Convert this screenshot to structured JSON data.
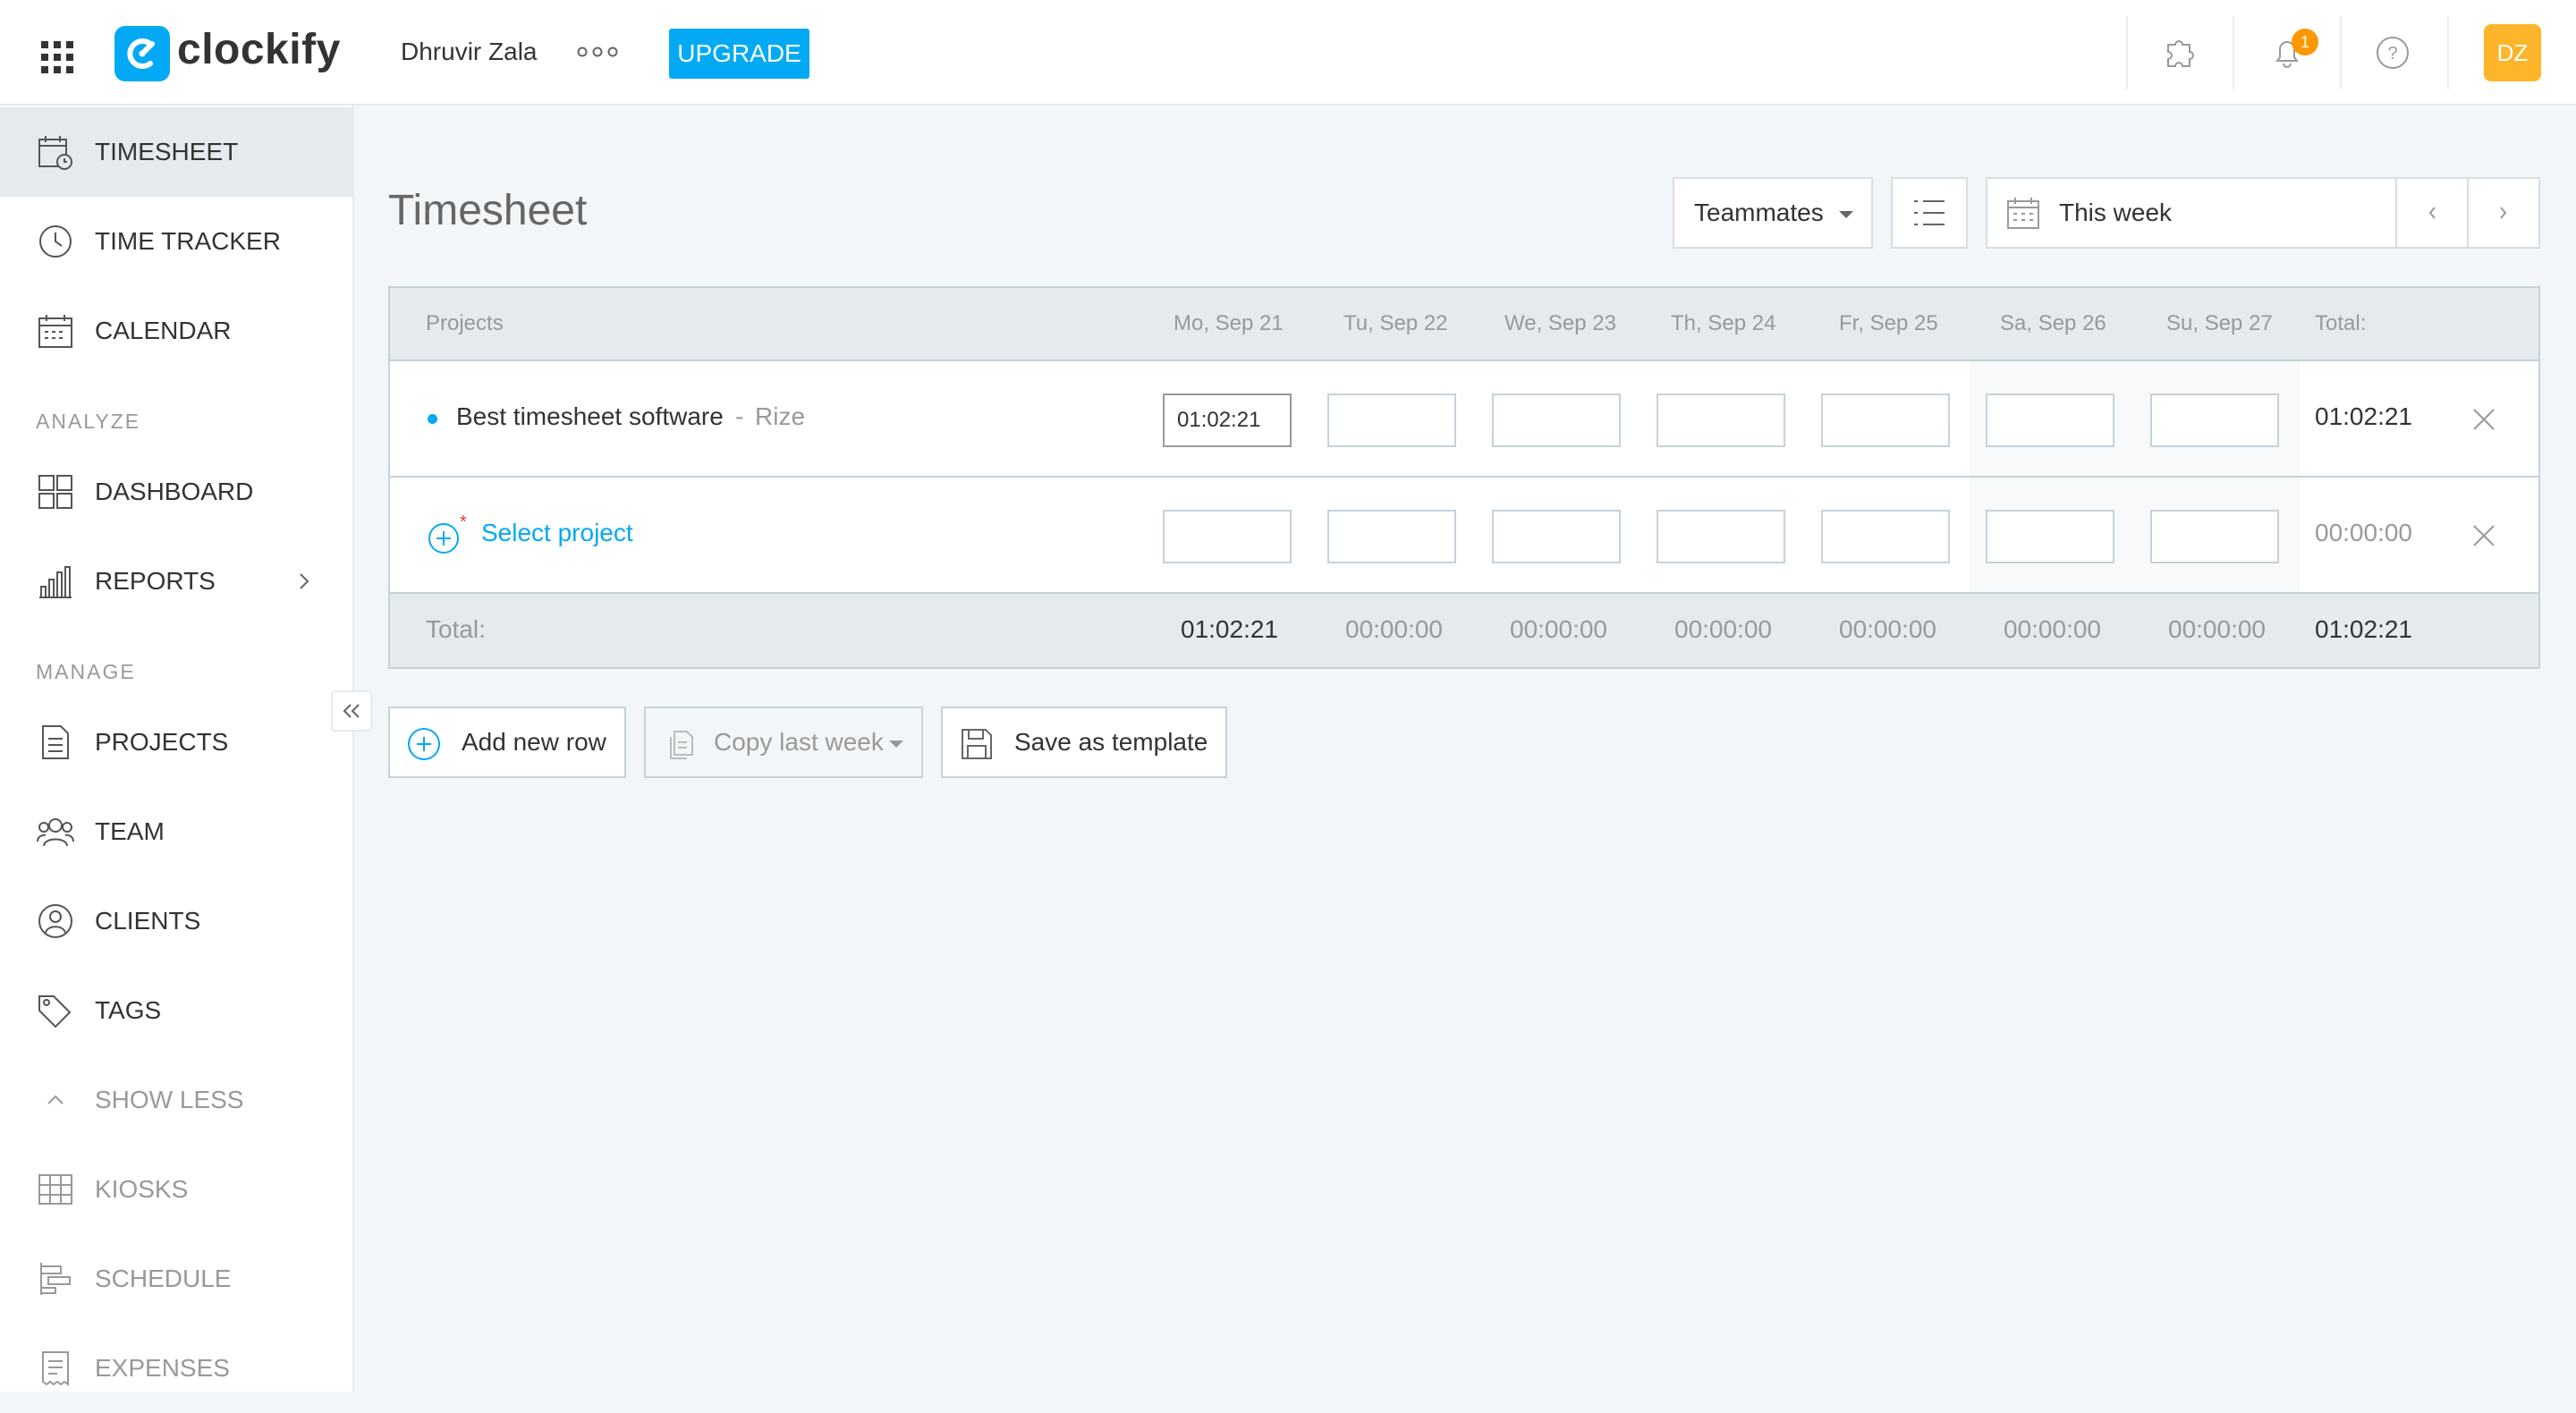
{
  "header": {
    "logo_text": "clockify",
    "workspace_name": "Dhruvir Zala",
    "upgrade_label": "UPGRADE",
    "notification_count": "1",
    "avatar_initials": "DZ"
  },
  "sidebar": {
    "items_top": [
      {
        "label": "TIMESHEET",
        "icon": "timesheet-icon",
        "active": true
      },
      {
        "label": "TIME TRACKER",
        "icon": "clock-icon"
      },
      {
        "label": "CALENDAR",
        "icon": "calendar-icon"
      }
    ],
    "analyze_label": "ANALYZE",
    "analyze_items": [
      {
        "label": "DASHBOARD",
        "icon": "dashboard-icon"
      },
      {
        "label": "REPORTS",
        "icon": "reports-icon"
      }
    ],
    "manage_label": "MANAGE",
    "manage_items": [
      {
        "label": "PROJECTS",
        "icon": "projects-icon"
      },
      {
        "label": "TEAM",
        "icon": "team-icon"
      },
      {
        "label": "CLIENTS",
        "icon": "clients-icon"
      },
      {
        "label": "TAGS",
        "icon": "tag-icon"
      }
    ],
    "show_less_label": "SHOW LESS",
    "more_items": [
      {
        "label": "KIOSKS",
        "icon": "kiosk-icon"
      },
      {
        "label": "SCHEDULE",
        "icon": "schedule-icon"
      },
      {
        "label": "EXPENSES",
        "icon": "expenses-icon"
      }
    ]
  },
  "main": {
    "title": "Timesheet",
    "teammates_label": "Teammates",
    "week_label": "This week",
    "table": {
      "projects_header": "Projects",
      "days": [
        "Mo, Sep 21",
        "Tu, Sep 22",
        "We, Sep 23",
        "Th, Sep 24",
        "Fr, Sep 25",
        "Sa, Sep 26",
        "Su, Sep 27"
      ],
      "total_header": "Total:",
      "rows": [
        {
          "project": "Best timesheet software",
          "separator": "-",
          "client": "Rize",
          "entries": [
            "01:02:21",
            "",
            "",
            "",
            "",
            "",
            ""
          ],
          "total": "01:02:21"
        },
        {
          "select_label": "Select project",
          "entries": [
            "",
            "",
            "",
            "",
            "",
            "",
            ""
          ],
          "total": "00:00:00"
        }
      ],
      "footer": {
        "label": "Total:",
        "day_totals": [
          "01:02:21",
          "00:00:00",
          "00:00:00",
          "00:00:00",
          "00:00:00",
          "00:00:00",
          "00:00:00"
        ],
        "grand_total": "01:02:21"
      }
    },
    "actions": {
      "add_row": "Add new row",
      "copy_last_week": "Copy last week",
      "save_template": "Save as template"
    }
  },
  "colors": {
    "accent": "#03a9f4",
    "badge": "#ff9800",
    "avatar": "#fdb52a",
    "required_asterisk": "#e53935"
  }
}
